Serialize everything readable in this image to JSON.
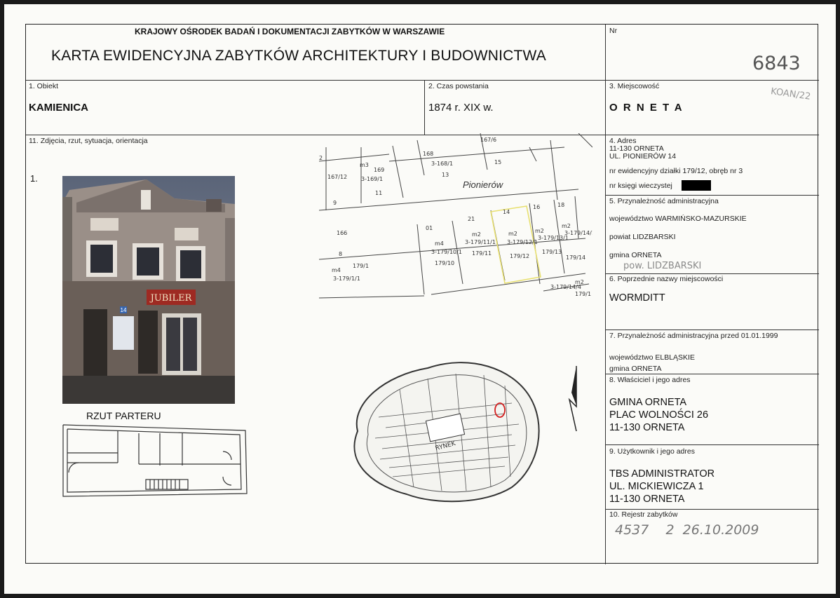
{
  "header": {
    "institution": "KRAJOWY OŚRODEK BADAŃ I DOKUMENTACJI ZABYTKÓW W WARSZAWIE",
    "title": "KARTA EWIDENCYJNA ZABYTKÓW ARCHITEKTURY I BUDOWNICTWA",
    "nr_label": "Nr",
    "nr_value": "6843",
    "nr_annotation": "KOAN/22"
  },
  "fields": {
    "obiekt_label": "1. Obiekt",
    "obiekt_value": "KAMIENICA",
    "czas_label": "2. Czas powstania",
    "czas_value": "1874 r. XIX w.",
    "miejscowosc_label": "3. Miejscowość",
    "miejscowosc_value": "O R N E T A",
    "zdjecia_label": "11. Zdjęcia, rzut, sytuacja, orientacja",
    "photo_number": "1.",
    "rzut_label": "RZUT PARTERU"
  },
  "adres": {
    "label": "4. Adres",
    "line1": "11-130 ORNETA",
    "line2": "UL. PIONIERÓW 14",
    "dzialka": "nr ewidencyjny działki 179/12, obręb nr 3",
    "ksiega": "nr księgi wieczystej"
  },
  "przynaleznosc": {
    "label": "5. Przynależność administracyjna",
    "wojewodztwo": "województwo WARMIŃSKO-MAZURSKIE",
    "powiat": "powiat LIDZBARSKI",
    "gmina": "gmina ORNETA",
    "handwritten": "pow. LIDZBARSKI"
  },
  "poprzednie": {
    "label": "6. Poprzednie nazwy miejscowości",
    "value": "WORMDITT"
  },
  "przed1999": {
    "label": "7. Przynależność administracyjna przed 01.01.1999",
    "wojewodztwo": "województwo ELBLĄSKIE",
    "gmina": "gmina ORNETA"
  },
  "wlasciciel": {
    "label": "8. Właściciel i jego adres",
    "line1": "GMINA ORNETA",
    "line2": "PLAC WOLNOŚCI 26",
    "line3": "11-130 ORNETA"
  },
  "uzytkownik": {
    "label": "9. Użytkownik i jego adres",
    "line1": "TBS ADMINISTRATOR",
    "line2": "UL. MICKIEWICZA 1",
    "line3": "11-130 ORNETA"
  },
  "rejestr": {
    "label": "10. Rejestr zabytków",
    "handwritten": "4537    2  26.10.2009"
  },
  "map": {
    "street": "Pionierów",
    "parcels": [
      "167/6",
      "168",
      "3-168/1",
      "13",
      "15",
      "2",
      "167/12",
      "m3",
      "169",
      "3-169/1",
      "11",
      "9",
      "166",
      "179/1",
      "m4",
      "3-179/1/1",
      "8",
      "01",
      "m4",
      "3-179/10/1",
      "179/10",
      "21",
      "m2",
      "3-179/11/1",
      "179/11",
      "14",
      "m2",
      "3-179/12/1",
      "179/12",
      "16",
      "m2",
      "3-179/13/1",
      "179/13",
      "18",
      "m2",
      "179/14",
      "3-179/14/1",
      "m2",
      "179/1"
    ],
    "rynek_label": "RYNEK",
    "sign": "JUBILER",
    "house_number": "14"
  },
  "colors": {
    "highlight": "#e8e070",
    "marker": "#d42020",
    "ink": "#333333"
  }
}
